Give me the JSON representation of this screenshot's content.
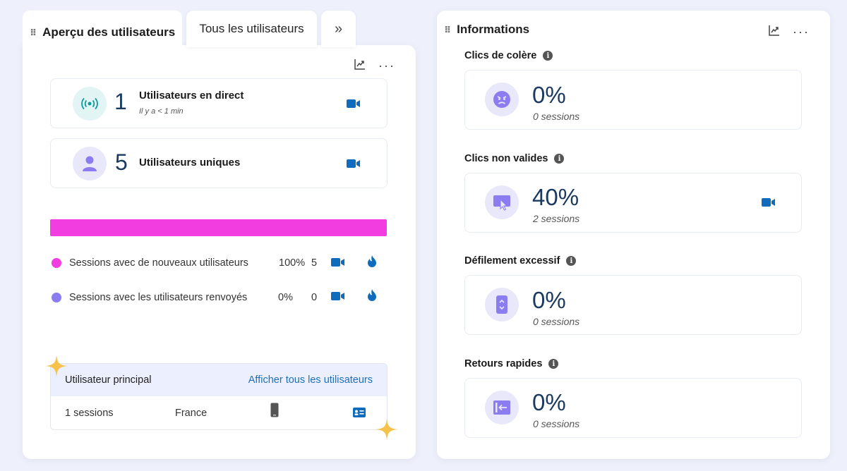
{
  "tabs": [
    {
      "label": "Aperçu des utilisateurs"
    },
    {
      "label": "Tous les utilisateurs"
    },
    {
      "label": "»"
    }
  ],
  "overview": {
    "live": {
      "count": "1",
      "label": "Utilisateurs en direct",
      "sub": "Il y a < 1 min"
    },
    "unique": {
      "count": "5",
      "label": "Utilisateurs uniques"
    },
    "bar": {
      "new_share": 1.0,
      "color": "#f23de0"
    },
    "legend": [
      {
        "label": "Sessions avec de nouveaux utilisateurs",
        "percent": "100%",
        "count": "5",
        "color": "#f23de0"
      },
      {
        "label": "Sessions avec les utilisateurs renvoyés",
        "percent": "0%",
        "count": "0",
        "color": "#8b7cf0"
      }
    ],
    "top_user": {
      "header": "Utilisateur principal",
      "link": "Afficher tous les utilisateurs",
      "sessions": "1 sessions",
      "country": "France"
    }
  },
  "insights": {
    "title": "Informations",
    "items": [
      {
        "title": "Clics de colère",
        "value": "0%",
        "sessions": "0 sessions",
        "icon": "angry-face-icon"
      },
      {
        "title": "Clics non valides",
        "value": "40%",
        "sessions": "2 sessions",
        "icon": "invalid-click-icon"
      },
      {
        "title": "Défilement excessif",
        "value": "0%",
        "sessions": "0 sessions",
        "icon": "scroll-icon"
      },
      {
        "title": "Retours rapides",
        "value": "0%",
        "sessions": "0 sessions",
        "icon": "quick-back-icon"
      }
    ]
  },
  "colors": {
    "accent": "#1f6fb8",
    "video": "#0f6cbd",
    "number": "#1b3a60"
  }
}
